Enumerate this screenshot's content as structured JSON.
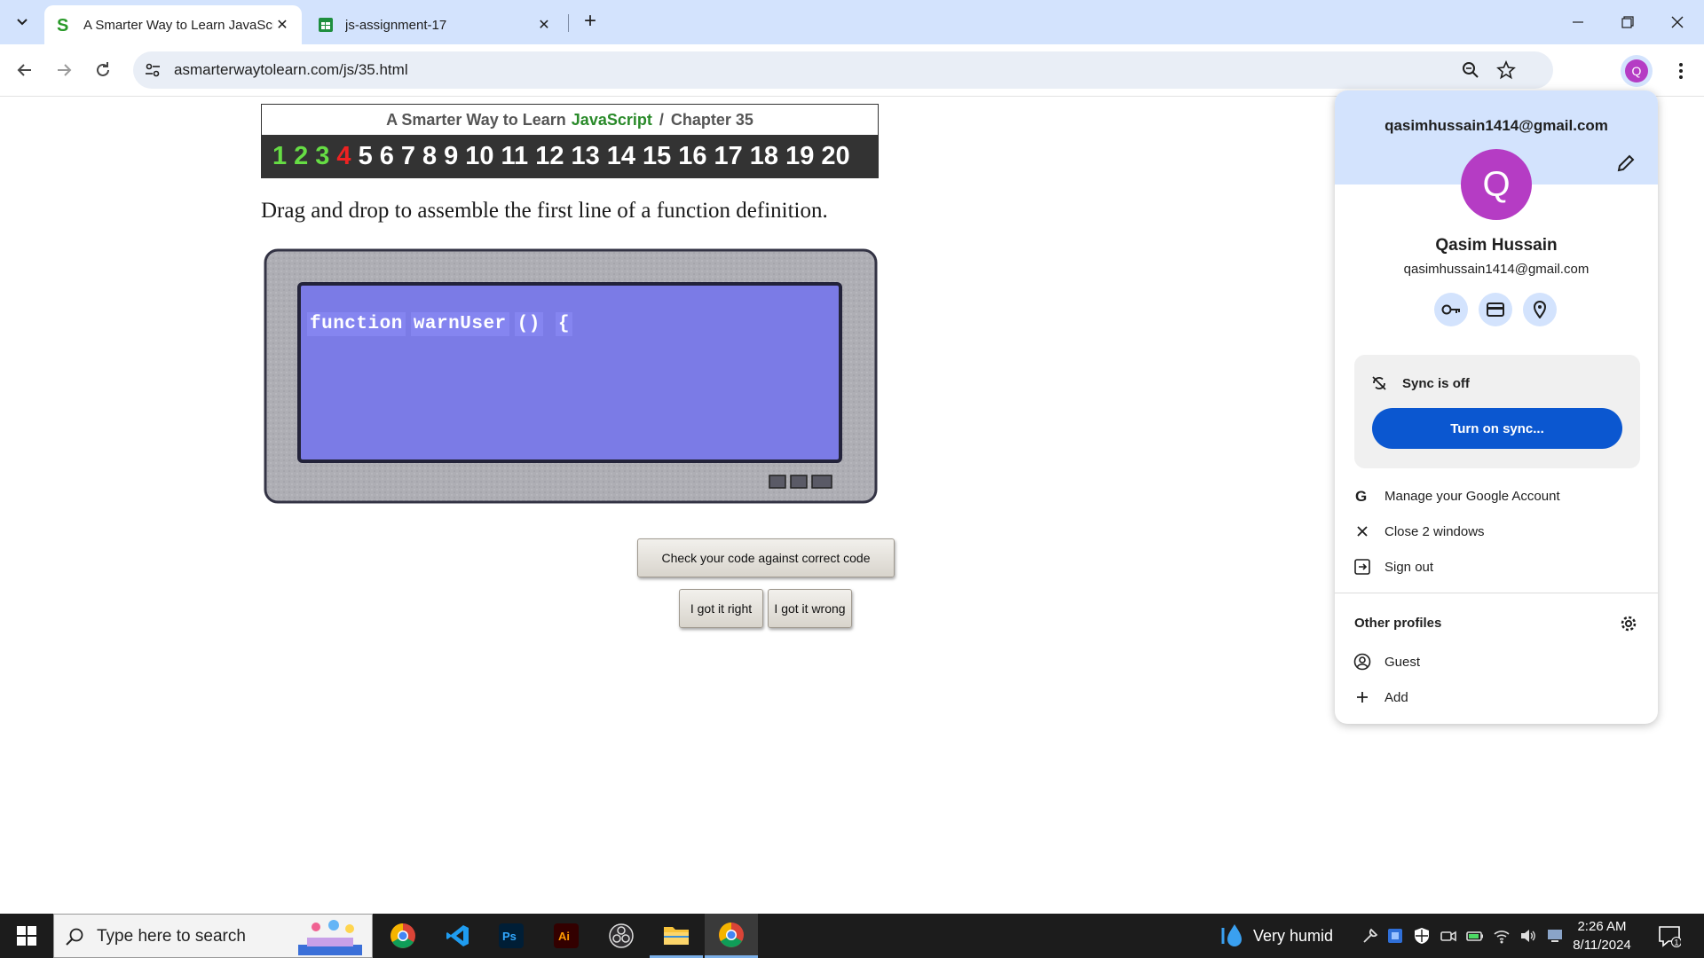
{
  "browser": {
    "tabs": [
      {
        "title": "A Smarter Way to Learn JavaScr",
        "favicon": "s-logo-icon",
        "active": true
      },
      {
        "title": "js-assignment-17",
        "favicon": "sheets-icon",
        "active": false
      }
    ],
    "url": "asmarterwaytolearn.com/js/35.html",
    "profile_initial": "Q"
  },
  "page": {
    "header": {
      "prefix": "A Smarter Way to Learn",
      "js": "JavaScript",
      "separator": "/",
      "chapter": "Chapter 35"
    },
    "chapter_nav": {
      "items": [
        "1",
        "2",
        "3",
        "4",
        "5",
        "6",
        "7",
        "8",
        "9",
        "10",
        "11",
        "12",
        "13",
        "14",
        "15",
        "16",
        "17",
        "18",
        "19",
        "20"
      ],
      "done": [
        "1",
        "2",
        "3"
      ],
      "current": "4"
    },
    "instructions": "Drag and drop to assemble the first line of a function definition.",
    "code_tokens": [
      "function",
      "warnUser",
      "()",
      "{"
    ],
    "buttons": {
      "check": "Check your code against correct code",
      "right": "I got it right",
      "wrong": "I got it wrong"
    },
    "colors": {
      "screen": "#7b7be6",
      "done_chapter": "#66dd44",
      "current_chapter": "#ee2222",
      "js_green": "#2a8a2a"
    }
  },
  "profile_menu": {
    "email_top": "qasimhussain1414@gmail.com",
    "avatar_initial": "Q",
    "name": "Qasim Hussain",
    "email": "qasimhussain1414@gmail.com",
    "quick_icons": [
      "key-icon",
      "credit-card-icon",
      "location-pin-icon"
    ],
    "sync_status": "Sync is off",
    "sync_button": "Turn on sync...",
    "items": [
      {
        "label": "Manage your Google Account",
        "icon": "google-icon"
      },
      {
        "label": "Close 2 windows",
        "icon": "close-icon"
      },
      {
        "label": "Sign out",
        "icon": "sign-out-icon"
      }
    ],
    "other_profiles_label": "Other profiles",
    "profiles": [
      {
        "label": "Guest",
        "icon": "guest-icon"
      },
      {
        "label": "Add",
        "icon": "plus-icon"
      }
    ],
    "accent": "#0b57d0",
    "avatar_color": "#b53cc4"
  },
  "taskbar": {
    "search_placeholder": "Type here to search",
    "apps": [
      "chrome-icon",
      "vscode-icon",
      "photoshop-icon",
      "illustrator-icon",
      "obs-icon",
      "file-explorer-icon",
      "chrome-active-icon"
    ],
    "weather": "Very humid",
    "time": "2:26 AM",
    "date": "8/11/2024",
    "notification_count": "1"
  }
}
